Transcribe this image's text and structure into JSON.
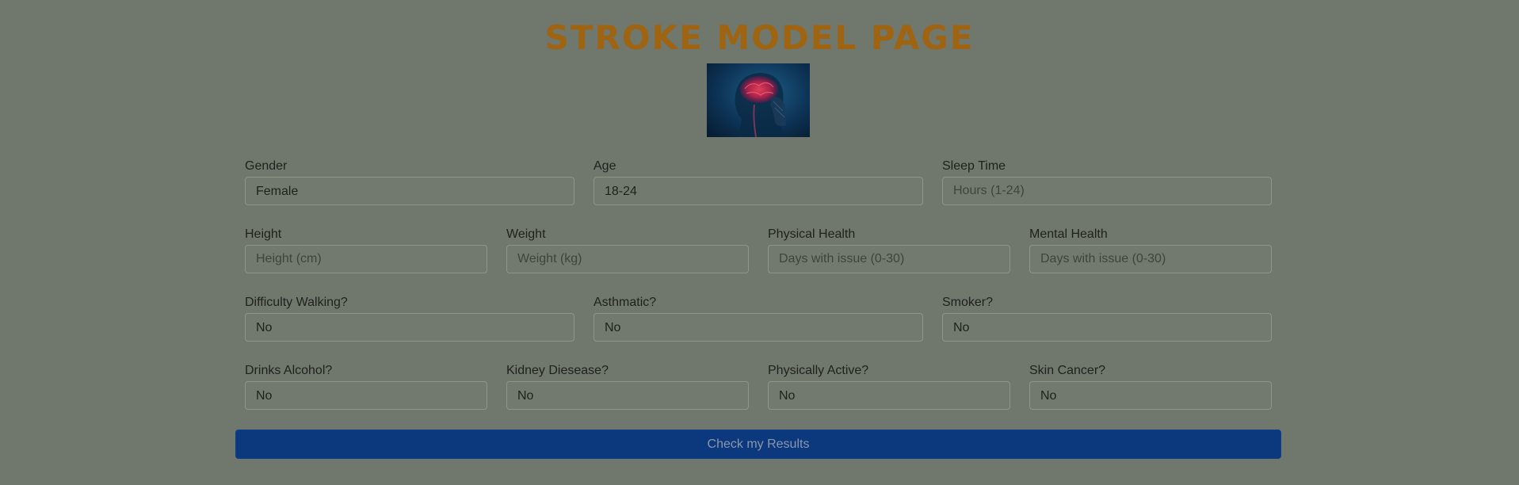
{
  "page": {
    "title": "STROKE MODEL PAGE",
    "title_color": "#9e6412",
    "background_color": "#70776d",
    "image_icon": "brain-xray-icon"
  },
  "form": {
    "row1": [
      {
        "label": "Gender",
        "value": "Female",
        "kind": "select"
      },
      {
        "label": "Age",
        "value": "18-24",
        "kind": "select"
      },
      {
        "label": "Sleep Time",
        "placeholder": "Hours (1-24)",
        "kind": "input"
      }
    ],
    "row2": [
      {
        "label": "Height",
        "placeholder": "Height (cm)",
        "kind": "input"
      },
      {
        "label": "Weight",
        "placeholder": "Weight (kg)",
        "kind": "input"
      },
      {
        "label": "Physical Health",
        "placeholder": "Days with issue (0-30)",
        "kind": "input"
      },
      {
        "label": "Mental Health",
        "placeholder": "Days with issue (0-30)",
        "kind": "input"
      }
    ],
    "row3": [
      {
        "label": "Difficulty Walking?",
        "value": "No",
        "kind": "select"
      },
      {
        "label": "Asthmatic?",
        "value": "No",
        "kind": "select"
      },
      {
        "label": "Smoker?",
        "value": "No",
        "kind": "select"
      }
    ],
    "row4": [
      {
        "label": "Drinks Alcohol?",
        "value": "No",
        "kind": "select"
      },
      {
        "label": "Kidney Diesease?",
        "value": "No",
        "kind": "select"
      },
      {
        "label": "Physically Active?",
        "value": "No",
        "kind": "select"
      },
      {
        "label": "Skin Cancer?",
        "value": "No",
        "kind": "select"
      }
    ]
  },
  "submit": {
    "label": "Check my Results",
    "color": "#0c397e"
  }
}
